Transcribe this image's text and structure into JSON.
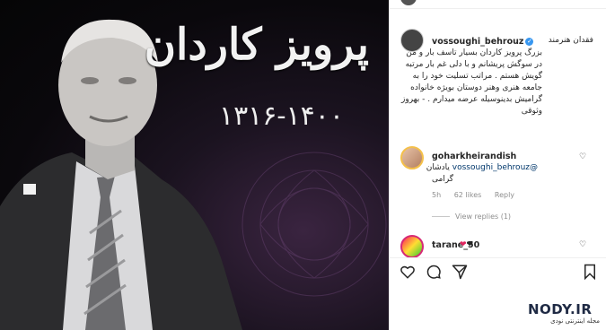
{
  "image": {
    "title_fa": "پرویز کاردان",
    "years_fa": "۱۳۱۶-۱۴۰۰"
  },
  "post": {
    "username": "vossoughi_behrouz",
    "caption_first": "فقدان هنرمند",
    "caption_lines": [
      "بزرگ پرویز کاردان بسیار تاسف بار و من",
      "در سوگش پریشانم و با دلی غم بار مرتبه",
      "گویش هستم . مراتب تسلیت خود را به",
      "جامعه هنری وهنر دوستان بویژه خانواده",
      "گرامیش بدینوسیله عرضه میدارم . - بهروز",
      "وثوقی"
    ]
  },
  "comments": [
    {
      "username": "goharkheirandish",
      "text_fa": "یادشان",
      "mention": "@vossoughi_behrouz",
      "text2_fa": "گرامی",
      "time": "5h",
      "likes": "62 likes",
      "reply": "Reply",
      "view_replies": "View replies (1)"
    },
    {
      "username": "tarane_50",
      "text": "❤️🖤"
    }
  ],
  "watermark": {
    "main": "NODY.IR",
    "sub": "مجله اینترنتی نودی"
  },
  "colors": {
    "verified": "#3897f0",
    "mention": "#00376b",
    "muted": "#8e8e8e"
  },
  "icons": [
    "heart-icon",
    "comment-icon",
    "share-icon",
    "bookmark-icon",
    "verified-icon"
  ]
}
